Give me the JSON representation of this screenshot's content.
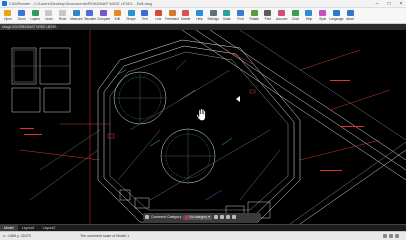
{
  "window": {
    "title": "CADReader - C:\\Users\\Desktop\\Documents\\ROADMAP WIDE LEVEL - Edit.dwg"
  },
  "toolbar": {
    "items": [
      {
        "label": "Open",
        "icon": "folder-open-icon",
        "color": "#e8a317"
      },
      {
        "label": "Zoom",
        "icon": "zoom-icon",
        "color": "#3a78d6"
      },
      {
        "label": "Layers",
        "icon": "layers-icon",
        "color": "#2f9e5b"
      },
      {
        "label": "Undo",
        "icon": "undo-icon",
        "color": "#c7c7c7"
      },
      {
        "label": "Redo",
        "icon": "redo-icon",
        "color": "#c7c7c7"
      },
      {
        "label": "Measure",
        "icon": "ruler-icon",
        "color": "#2c86c9"
      },
      {
        "label": "Tabulate",
        "icon": "table-icon",
        "color": "#4f6fd0"
      },
      {
        "label": "Compare",
        "icon": "compare-icon",
        "color": "#7a57c9"
      },
      {
        "label": "Edit",
        "icon": "pencil-icon",
        "color": "#e38a1e"
      },
      {
        "label": "Shape",
        "icon": "shape-icon",
        "color": "#2f8fd3"
      },
      {
        "label": "Text",
        "icon": "text-icon",
        "color": "#3b6bd3"
      },
      {
        "label": "Line",
        "icon": "line-icon",
        "color": "#d34b3b"
      },
      {
        "label": "Freehand",
        "icon": "freehand-icon",
        "color": "#d77a2b"
      },
      {
        "label": "Delete",
        "icon": "eraser-icon",
        "color": "#d9534f"
      },
      {
        "label": "Help",
        "icon": "help-icon",
        "color": "#2e8bd6"
      },
      {
        "label": "Settings",
        "icon": "gear-icon",
        "color": "#5e6e80"
      },
      {
        "label": "Scale",
        "icon": "scale-icon",
        "color": "#2aa198"
      },
      {
        "label": "Find",
        "icon": "search-icon",
        "color": "#3b7bd4"
      },
      {
        "label": "Rotate",
        "icon": "rotate-icon",
        "color": "#5a9a3d"
      },
      {
        "label": "Print",
        "icon": "printer-icon",
        "color": "#5b5b5b"
      },
      {
        "label": "Account",
        "icon": "account-icon",
        "color": "#d04e7e"
      },
      {
        "label": "Chat",
        "icon": "chat-icon",
        "color": "#3a9e4d"
      },
      {
        "label": "Help",
        "icon": "help-circle-icon",
        "color": "#2e8bd6"
      },
      {
        "label": "Style",
        "icon": "style-icon",
        "color": "#c94fc0"
      },
      {
        "label": "Language",
        "icon": "language-icon",
        "color": "#3178c6"
      },
      {
        "label": "about",
        "icon": "info-icon",
        "color": "#3178c6"
      }
    ]
  },
  "document_tab": {
    "label": "xbsgs KDOEB03MAT WIDE LEVEL",
    "close": "×"
  },
  "floating_toolbar": {
    "category_label": "Comment Category",
    "category_value": "No category"
  },
  "layout_tabs": [
    "Model",
    "Layout1",
    "Layout2"
  ],
  "status": {
    "coords": "x: -1469 y: 32470",
    "message": "The comment scale of Model 1"
  },
  "colors": {
    "canvas_bg": "#000000",
    "line_white": "#e6e6e6",
    "line_red": "#e0312b",
    "line_green": "#3fd13f",
    "line_blue": "#3a6df0"
  }
}
